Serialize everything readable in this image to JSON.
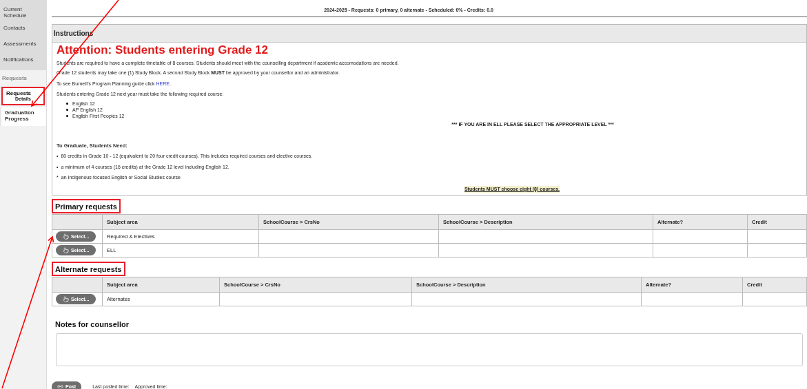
{
  "sidebar": {
    "group_items": [
      {
        "label": "Current Schedule"
      },
      {
        "label": "Contacts"
      },
      {
        "label": "Assessments"
      },
      {
        "label": "Notifications"
      }
    ],
    "section_label": "Requests",
    "items": [
      {
        "label": "Requests",
        "sublabel": "Details",
        "selected": true
      },
      {
        "label": "Graduation Progress",
        "selected": false
      }
    ]
  },
  "status": "2024-2025 - Requests: 0 primary, 0 alternate - Scheduled: 0% - Credits: 0.0",
  "instructions": {
    "title": "Instructions",
    "heading": "Attention: Students entering Grade 12",
    "paragraphs": [
      "Students are required to have a complete timetable of 8 courses. Students should meet with the counselling department if academic accomodations are needed.",
      "Grade 12 students may take one (1) Study Block.  A *second* Study Block **MUST** be approved by your counsellor and an administrator."
    ],
    "link_line": {
      "before": "To see Burnett's Program Planning guide click ",
      "link": "HERE",
      "after": "."
    },
    "required_intro": "Students entering Grade 12 next year must take the  following required course:",
    "required_courses": [
      "English 12",
      "AP English 12",
      "English First Peoples 12"
    ],
    "ell_notice": "*** IF YOU ARE IN ELL PLEASE SELECT THE APPROPRIATE LEVEL ***",
    "graduate_heading": "To Graduate, Students Need:",
    "graduate_items": [
      {
        "marker": "•",
        "text": "80 credits in Grade 10 - 12 (equivalent to 20 four credit courses).  This includes required courses and elective courses."
      },
      {
        "marker": "•",
        "text": "a minimum of 4 courses (16 credits) at the Grade 12 level including English 12."
      },
      {
        "marker": "*",
        "text": "an Indigenous-focused English or Social Studies course"
      }
    ],
    "choose_notice": "Students MUST choose eight (8) courses."
  },
  "primary": {
    "title": "Primary requests",
    "columns": [
      "Subject area",
      "SchoolCourse > CrsNo",
      "SchoolCourse > Description",
      "Alternate?",
      "Credit"
    ],
    "rows": [
      {
        "button": "Select...",
        "subject": "Required & Electives"
      },
      {
        "button": "Select...",
        "subject": "ELL"
      }
    ]
  },
  "alternate": {
    "title": "Alternate requests",
    "columns": [
      "Subject area",
      "SchoolCourse > CrsNo",
      "SchoolCourse > Description",
      "Alternate?",
      "Credit"
    ],
    "rows": [
      {
        "button": "Select...",
        "subject": "Alternates"
      }
    ]
  },
  "notes": {
    "title": "Notes for counsellor"
  },
  "footer": {
    "post_button": "Post",
    "last_posted": "Last posted time:",
    "approved": "Approved time:"
  }
}
